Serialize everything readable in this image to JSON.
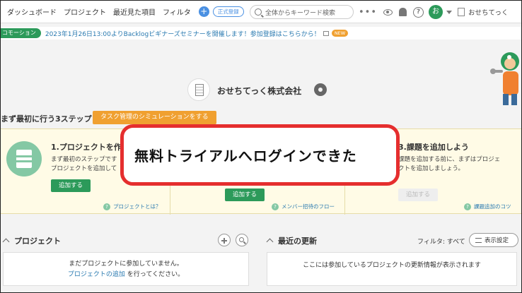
{
  "nav": {
    "items": [
      "ダッシュボード",
      "プロジェクト",
      "最近見た項目",
      "フィルタ"
    ],
    "plus_label": "+",
    "upgrade_label": "正式登録",
    "search_placeholder": "全体からキーワード検索",
    "dots": "•••",
    "help": "?",
    "avatar_initial": "お",
    "space_name": "おせちてっく"
  },
  "announcement": {
    "tag": "コモーション",
    "text": "2023年1月26日13:00よりBacklogビギナーズセミナーを開催します！参加登録はこちらから！",
    "badge": "NEW"
  },
  "space": {
    "title": "おせちてっく株式会社"
  },
  "steps": {
    "heading": "まず最初に行う3ステップ",
    "simulation_button": "タスク管理のシミュレーションをする",
    "step1": {
      "title": "1.プロジェクトを作",
      "desc_line1": "まず最初のステップです",
      "desc_line2": "プロジェクトを追加して",
      "button": "追加する",
      "help": "プロジェクトとは？"
    },
    "step2": {
      "button": "追加する",
      "help": "メンバー招待のフロー"
    },
    "step3": {
      "title": "3.課題を追加しよう",
      "desc_line1": "課題を追加する前に、まずはプロジェ",
      "desc_line2": "クトを追加しましょう。",
      "button": "追加する",
      "help": "課題追加のコツ"
    }
  },
  "callout": {
    "text": "無料トライアルへログインできた"
  },
  "projects": {
    "title": "プロジェクト",
    "empty_line1": "まだプロジェクトに参加していません。",
    "empty_link": "プロジェクトの追加",
    "empty_line2_suffix": " を行ってください。"
  },
  "updates": {
    "title": "最近の更新",
    "filter": "フィルタ: すべて",
    "settings_button": "表示設定",
    "empty_text": "ここには参加しているプロジェクトの更新情報が表示されます"
  },
  "colors": {
    "brand_green": "#2c9a5a",
    "accent_orange": "#f0a030",
    "callout_red": "#e52e2e",
    "link_blue": "#2a7ab0"
  }
}
